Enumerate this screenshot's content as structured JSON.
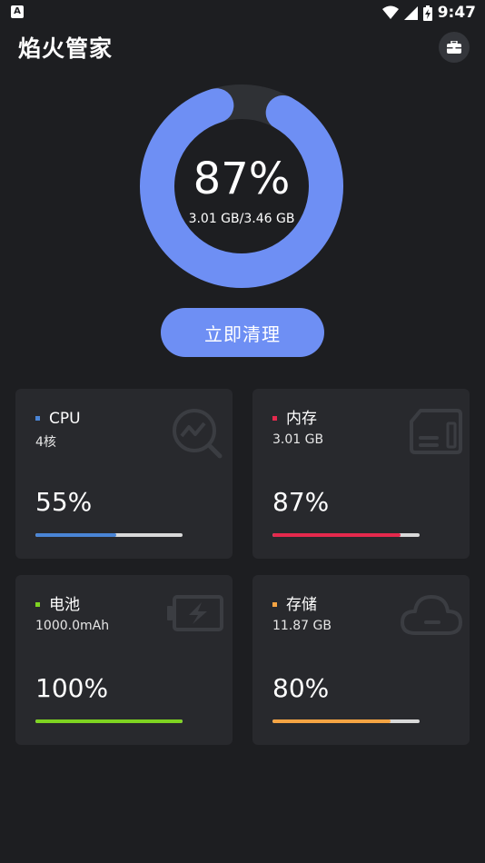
{
  "status_bar": {
    "time": "9:47",
    "left_icon_letter": "A"
  },
  "app": {
    "title": "焰火管家"
  },
  "gauge": {
    "percent_text": "87%",
    "percent": 87,
    "detail": "3.01 GB/3.46 GB",
    "color": "#6e8ff4"
  },
  "clean_button": {
    "label": "立即清理"
  },
  "cards": [
    {
      "title": "CPU",
      "subtitle": "4核",
      "percent_text": "55%",
      "percent": 55,
      "color": "#4a85d6",
      "icon": "chart-search-icon"
    },
    {
      "title": "内存",
      "subtitle": "3.01 GB",
      "percent_text": "87%",
      "percent": 87,
      "color": "#e5294d",
      "icon": "memory-card-icon"
    },
    {
      "title": "电池",
      "subtitle": "1000.0mAh",
      "percent_text": "100%",
      "percent": 100,
      "color": "#7ed321",
      "icon": "battery-charging-icon"
    },
    {
      "title": "存储",
      "subtitle": "11.87 GB",
      "percent_text": "80%",
      "percent": 80,
      "color": "#f5a443",
      "icon": "cloud-icon"
    }
  ]
}
